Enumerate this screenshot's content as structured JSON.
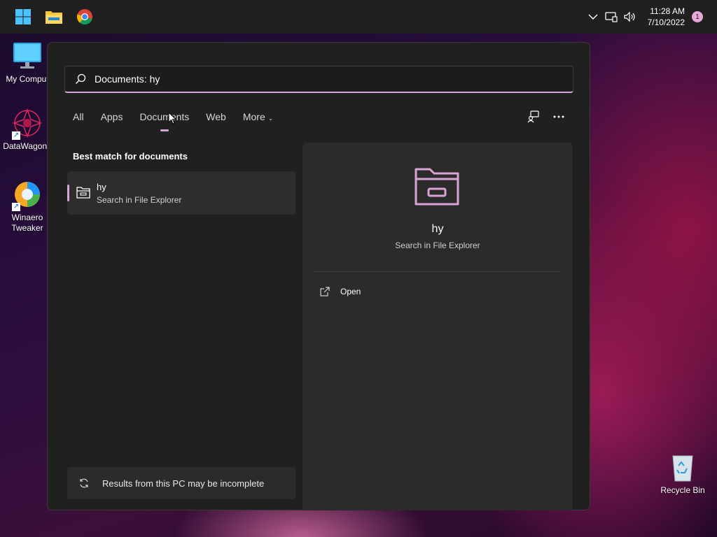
{
  "taskbar": {
    "apps": [
      {
        "name": "start",
        "icon": "windows-logo-icon"
      },
      {
        "name": "file-explorer",
        "icon": "folder-icon"
      },
      {
        "name": "chrome",
        "icon": "chrome-icon"
      }
    ],
    "tray": {
      "icons": [
        "chevron-up-icon",
        "network-icon",
        "volume-icon"
      ],
      "time": "11:28 AM",
      "date": "7/10/2022",
      "notification_count": "1"
    }
  },
  "desktop": {
    "icons": [
      {
        "label": "My Comput",
        "icon": "monitor-icon"
      },
      {
        "label": "DataWagon..",
        "icon": "datawagon-icon"
      },
      {
        "label": "Winaero Tweaker",
        "icon": "winaero-icon"
      },
      {
        "label": "Recycle Bin",
        "icon": "recycle-bin-icon"
      }
    ]
  },
  "search": {
    "query": "Documents: hy",
    "tabs": [
      {
        "label": "All"
      },
      {
        "label": "Apps"
      },
      {
        "label": "Documents",
        "active": true
      },
      {
        "label": "Web"
      },
      {
        "label": "More"
      }
    ],
    "section_title": "Best match for documents",
    "best_match": {
      "title": "hy",
      "subtitle": "Search in File Explorer"
    },
    "preview": {
      "title": "hy",
      "subtitle": "Search in File Explorer",
      "action_label": "Open"
    },
    "footer_note": "Results from this PC may be incomplete"
  },
  "colors": {
    "accent": "#d9a3d6",
    "panel_bg": "#202020",
    "taskbar_bg": "#202020"
  }
}
